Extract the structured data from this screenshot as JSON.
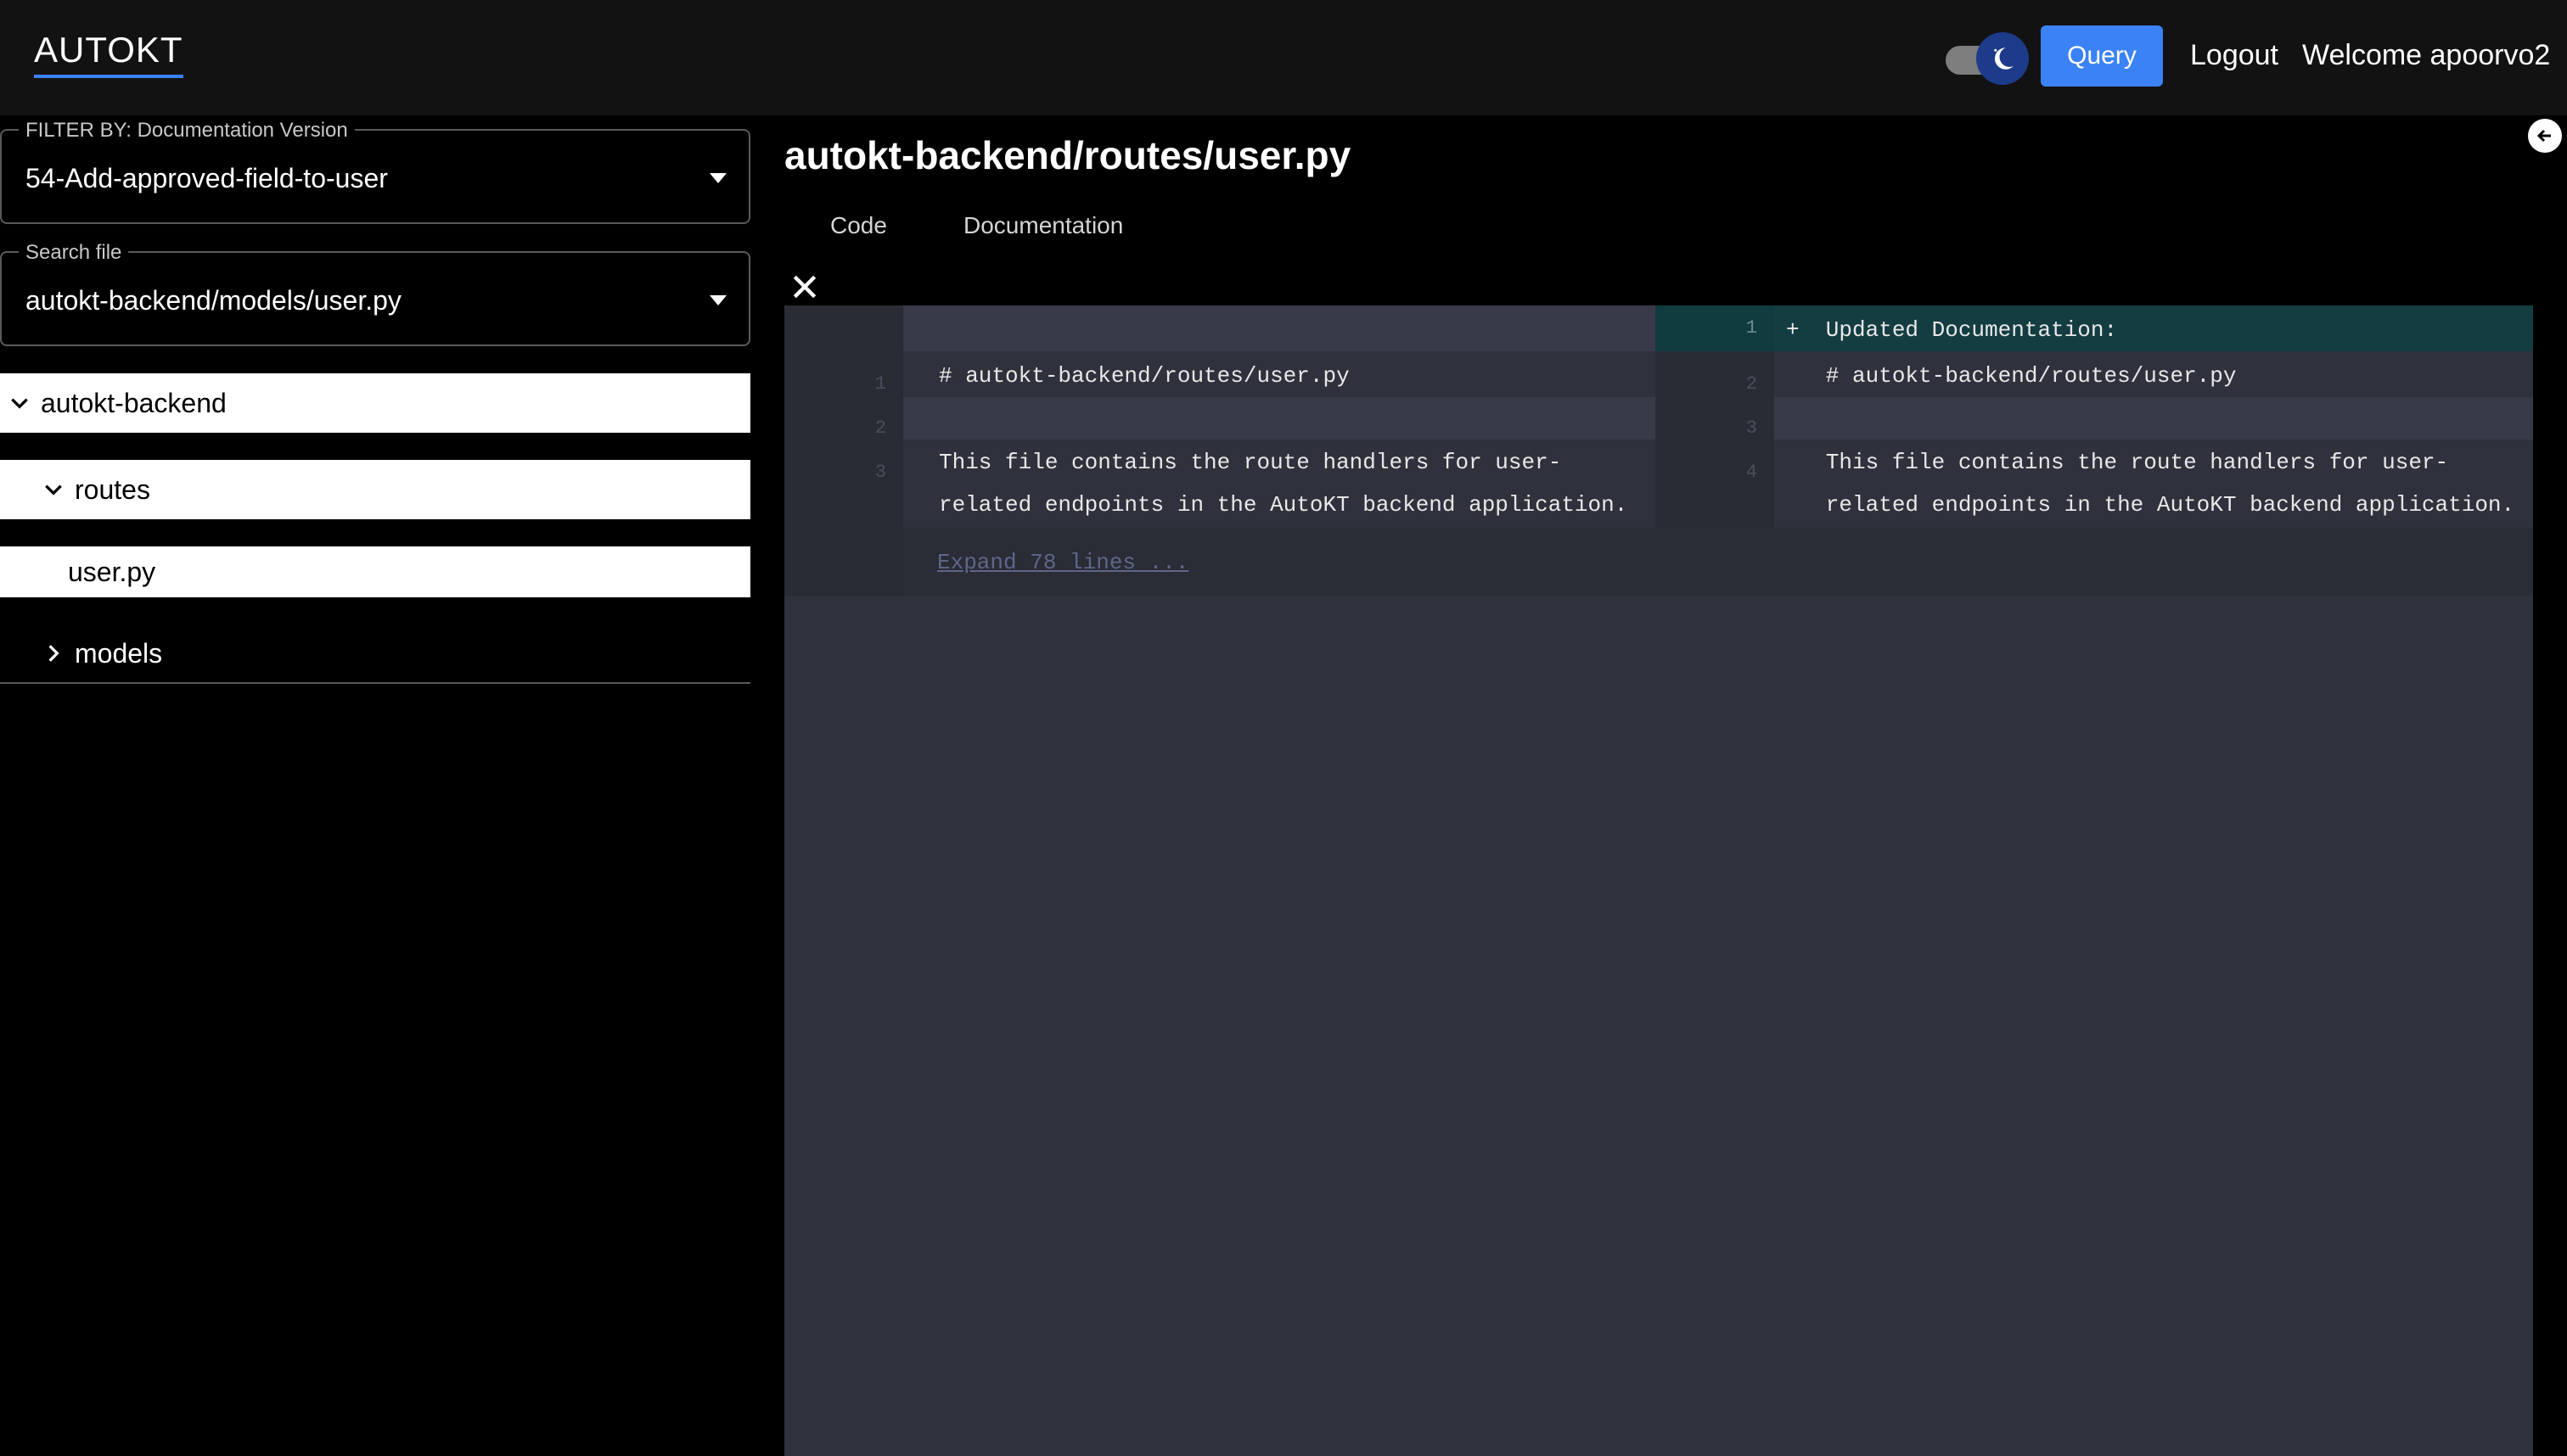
{
  "app": {
    "brand": "AUTOKT"
  },
  "header": {
    "query_label": "Query",
    "logout_label": "Logout",
    "welcome_text": "Welcome apoorvo2"
  },
  "sidebar": {
    "version_filter": {
      "label": "FILTER BY: Documentation Version",
      "value": "54-Add-approved-field-to-user"
    },
    "search_file": {
      "label": "Search file",
      "value": "autokt-backend/models/user.py"
    },
    "tree": {
      "root": "autokt-backend",
      "routes": "routes",
      "file": "user.py",
      "models": "models"
    }
  },
  "main": {
    "title": "autokt-backend/routes/user.py",
    "tabs": [
      {
        "label": "Code"
      },
      {
        "label": "Documentation"
      }
    ]
  },
  "diff": {
    "left": {
      "line_numbers": [
        "1",
        "2",
        "3"
      ],
      "line1": "# autokt-backend/routes/user.py",
      "line3a": "This file contains the route handlers for user-",
      "line3b": "related endpoints in the AutoKT backend application."
    },
    "right": {
      "line_numbers": [
        "1",
        "2",
        "3",
        "4"
      ],
      "line1": "+  Updated Documentation:",
      "line2": "   # autokt-backend/routes/user.py",
      "line4a": "   This file contains the route handlers for user-",
      "line4b": "   related endpoints in the AutoKT backend application."
    },
    "expand_label": "Expand 78 lines ..."
  },
  "colors": {
    "accent": "#3b82f6",
    "added_line": "#103b3f",
    "diff_bg": "#2f323d"
  }
}
